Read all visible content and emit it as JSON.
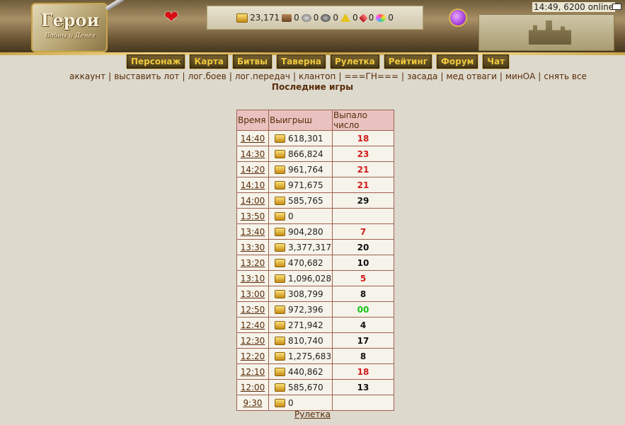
{
  "header": {
    "logo_title": "Герои",
    "logo_subtitle": "Войны и Денег",
    "online_text": "14:49, 6200 online",
    "resources": {
      "gold": "23,171",
      "wood": "0",
      "ore": "0",
      "mercury": "0",
      "sulfur": "0",
      "crystal": "0",
      "gems": "0"
    }
  },
  "menu": {
    "items": [
      "Персонаж",
      "Карта",
      "Битвы",
      "Таверна",
      "Рулетка",
      "Рейтинг",
      "Форум",
      "Чат"
    ]
  },
  "submenu": {
    "items": [
      "аккаунт",
      "выставить лот",
      "лог.боев",
      "лог.передач",
      "клантоп",
      "===ГН===",
      "засада",
      "мед отваги",
      "минОА",
      "снять все"
    ]
  },
  "page_title": "Последние игры",
  "table": {
    "headers": [
      "Время",
      "Выигрыш",
      "Выпало число"
    ],
    "rows": [
      {
        "time": "14:40",
        "win": "618,301",
        "number": "18"
      },
      {
        "time": "14:30",
        "win": "866,824",
        "number": "23"
      },
      {
        "time": "14:20",
        "win": "961,764",
        "number": "21"
      },
      {
        "time": "14:10",
        "win": "971,675",
        "number": "21"
      },
      {
        "time": "14:00",
        "win": "585,765",
        "number": "29"
      },
      {
        "time": "13:50",
        "win": "0",
        "number": ""
      },
      {
        "time": "13:40",
        "win": "904,280",
        "number": "7"
      },
      {
        "time": "13:30",
        "win": "3,377,317",
        "number": "20"
      },
      {
        "time": "13:20",
        "win": "470,682",
        "number": "10"
      },
      {
        "time": "13:10",
        "win": "1,096,028",
        "number": "5"
      },
      {
        "time": "13:00",
        "win": "308,799",
        "number": "8"
      },
      {
        "time": "12:50",
        "win": "972,396",
        "number": "00"
      },
      {
        "time": "12:40",
        "win": "271,942",
        "number": "4"
      },
      {
        "time": "12:30",
        "win": "810,740",
        "number": "17"
      },
      {
        "time": "12:20",
        "win": "1,275,683",
        "number": "8"
      },
      {
        "time": "12:10",
        "win": "440,862",
        "number": "18"
      },
      {
        "time": "12:00",
        "win": "585,670",
        "number": "13"
      },
      {
        "time": "9:30",
        "win": "0",
        "number": ""
      }
    ]
  },
  "number_colors": {
    "red": "#d11b1b",
    "black": "#111111",
    "green": "#13c613"
  },
  "footer_link": "Рулетка"
}
